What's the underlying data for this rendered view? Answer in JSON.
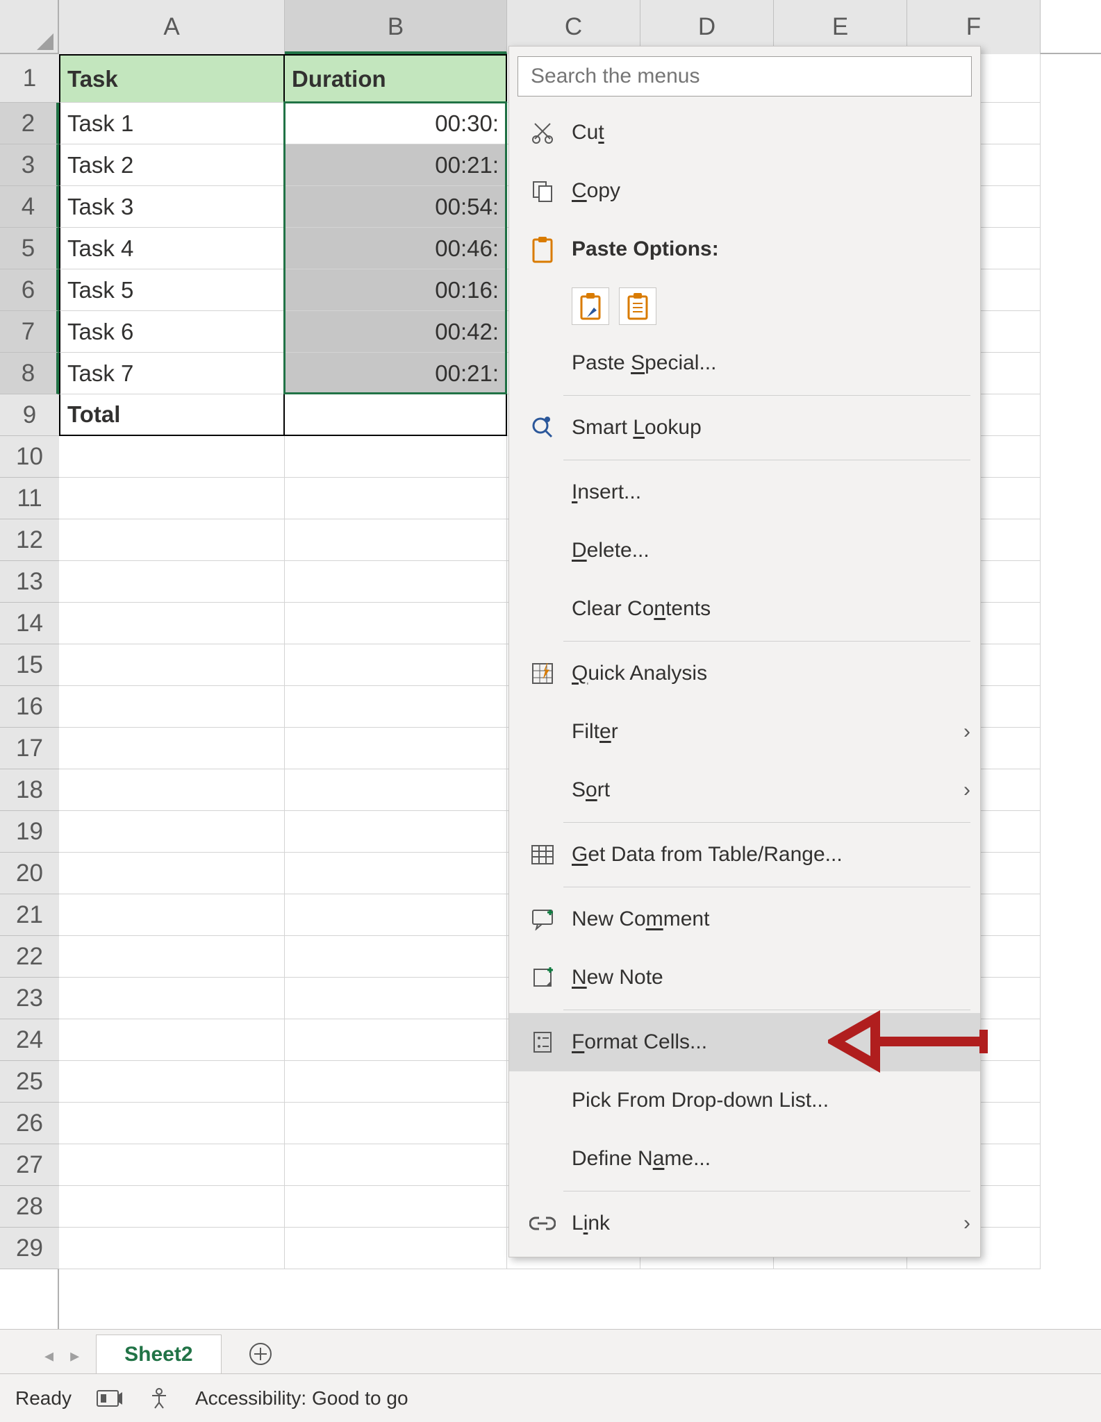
{
  "columns": [
    "A",
    "B",
    "C",
    "D",
    "E",
    "F"
  ],
  "row_count": 29,
  "selected_col": "B",
  "selected_rows": [
    2,
    3,
    4,
    5,
    6,
    7,
    8
  ],
  "table": {
    "header": {
      "A": "Task",
      "B": "Duration"
    },
    "rows": [
      {
        "A": "Task 1",
        "B": "00:30:"
      },
      {
        "A": "Task 2",
        "B": "00:21:"
      },
      {
        "A": "Task 3",
        "B": "00:54:"
      },
      {
        "A": "Task 4",
        "B": "00:46:"
      },
      {
        "A": "Task 5",
        "B": "00:16:"
      },
      {
        "A": "Task 6",
        "B": "00:42:"
      },
      {
        "A": "Task 7",
        "B": "00:21:"
      }
    ],
    "total_row": {
      "A": "Total",
      "B": ""
    }
  },
  "context_menu": {
    "search_placeholder": "Search the menus",
    "items": [
      {
        "kind": "item",
        "icon": "cut",
        "label": "Cut",
        "u": "t"
      },
      {
        "kind": "item",
        "icon": "copy",
        "label": "Copy",
        "u": "C"
      },
      {
        "kind": "item",
        "icon": "paste",
        "label": "Paste Options:",
        "bold": true
      },
      {
        "kind": "paste_options",
        "options": [
          "paste-brush",
          "paste-plain"
        ]
      },
      {
        "kind": "item",
        "label": "Paste Special...",
        "u": "S"
      },
      {
        "kind": "sep"
      },
      {
        "kind": "item",
        "icon": "lookup",
        "label": "Smart Lookup",
        "u": "L"
      },
      {
        "kind": "sep"
      },
      {
        "kind": "item",
        "label": "Insert...",
        "u": "I"
      },
      {
        "kind": "item",
        "label": "Delete...",
        "u": "D"
      },
      {
        "kind": "item",
        "label": "Clear Contents",
        "u": "n"
      },
      {
        "kind": "sep"
      },
      {
        "kind": "item",
        "icon": "quick",
        "label": "Quick Analysis",
        "u": "Q"
      },
      {
        "kind": "item",
        "label": "Filter",
        "u": "e",
        "sub": true
      },
      {
        "kind": "item",
        "label": "Sort",
        "u": "o",
        "sub": true
      },
      {
        "kind": "sep"
      },
      {
        "kind": "item",
        "icon": "table",
        "label": "Get Data from Table/Range...",
        "u": "G"
      },
      {
        "kind": "sep"
      },
      {
        "kind": "item",
        "icon": "comment",
        "label": "New Comment",
        "u": "m"
      },
      {
        "kind": "item",
        "icon": "note",
        "label": "New Note",
        "u": "N"
      },
      {
        "kind": "sep"
      },
      {
        "kind": "item",
        "icon": "format",
        "label": "Format Cells...",
        "u": "F",
        "highlight": true
      },
      {
        "kind": "item",
        "label": "Pick From Drop-down List...",
        "u": "K"
      },
      {
        "kind": "item",
        "label": "Define Name...",
        "u": "a"
      },
      {
        "kind": "sep"
      },
      {
        "kind": "item",
        "icon": "link",
        "label": "Link",
        "u": "i",
        "sub": true
      }
    ]
  },
  "sheet_tab": "Sheet2",
  "status": {
    "state": "Ready",
    "accessibility": "Accessibility: Good to go"
  },
  "annotation_arrow_points_to": "Format Cells..."
}
